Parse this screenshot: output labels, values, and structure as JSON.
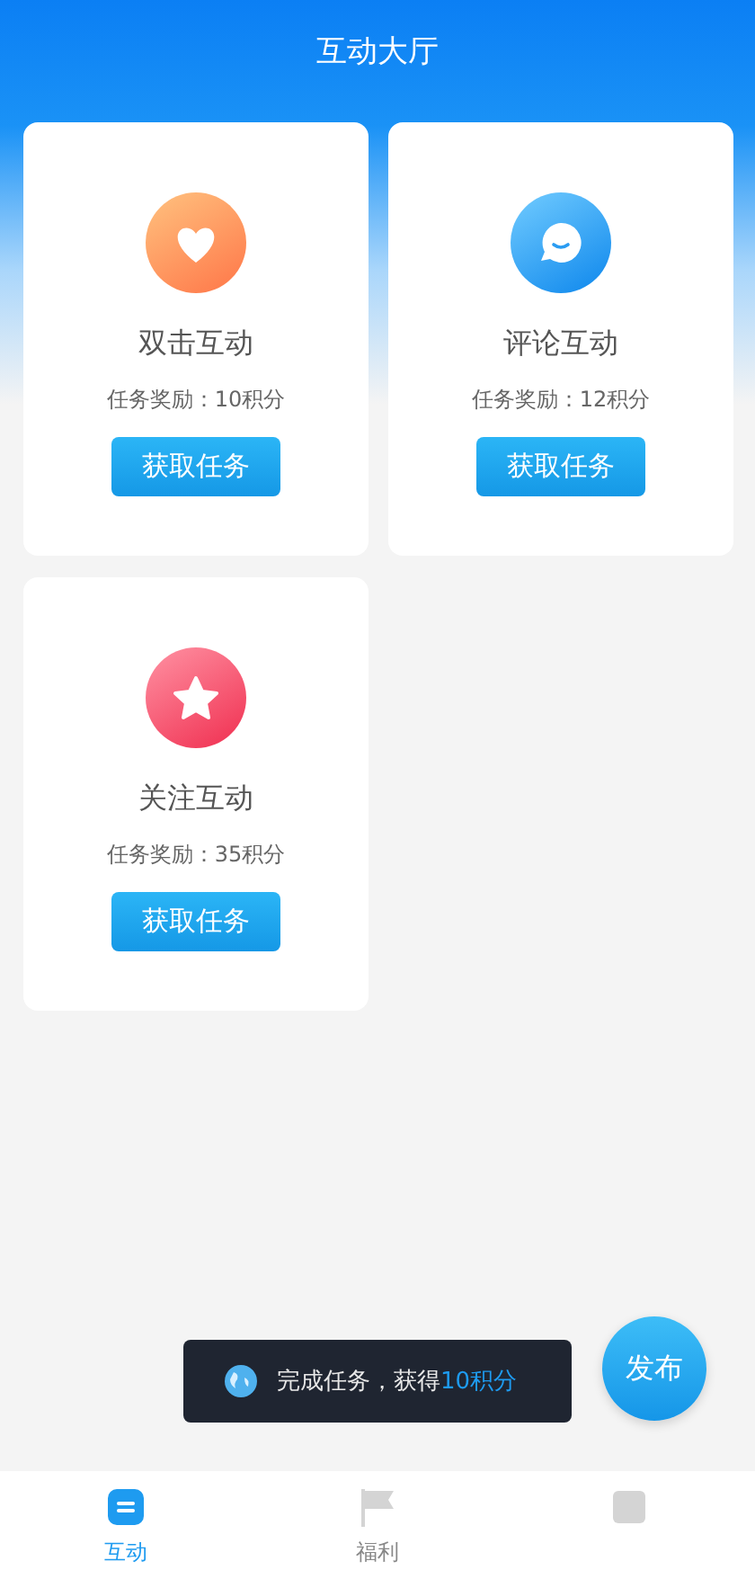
{
  "header": {
    "title": "互动大厅"
  },
  "tasks": [
    {
      "kind": "heart",
      "title": "双击互动",
      "reward": "任务奖励：10积分",
      "button": "获取任务"
    },
    {
      "kind": "comment",
      "title": "评论互动",
      "reward": "任务奖励：12积分",
      "button": "获取任务"
    },
    {
      "kind": "star",
      "title": "关注互动",
      "reward": "任务奖励：35积分",
      "button": "获取任务"
    }
  ],
  "toast": {
    "text": "完成任务，获得**10积分**"
  },
  "fab": {
    "label": "发布"
  },
  "tab_bar": [
    {
      "kind": "chat",
      "label": "互动",
      "selected": true
    },
    {
      "kind": "flag",
      "label": "福利",
      "selected": false
    },
    {
      "kind": "box",
      "selected": false
    }
  ]
}
